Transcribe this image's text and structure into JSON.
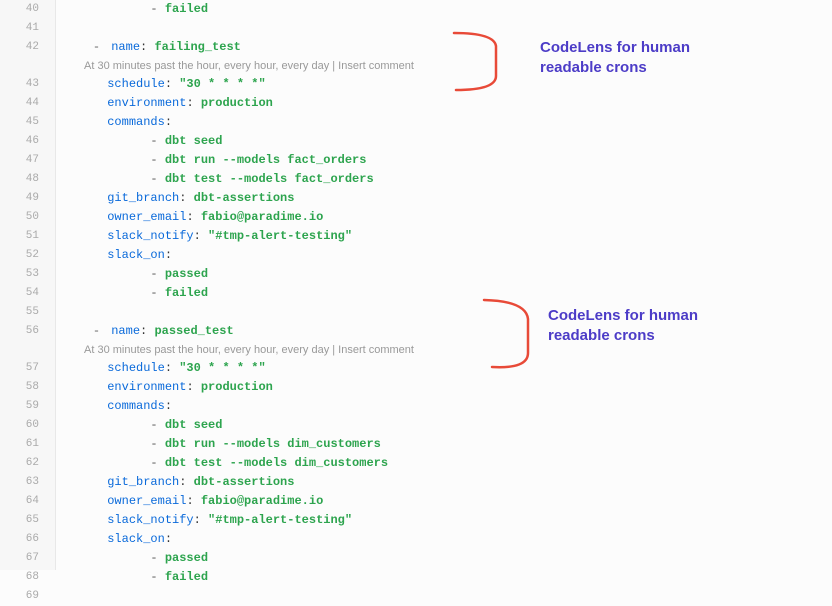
{
  "lines": [
    {
      "num": "40",
      "type": "code",
      "indent": "            ",
      "dash": true,
      "value": "failed"
    },
    {
      "num": "41",
      "type": "blank"
    },
    {
      "num": "42",
      "type": "fold",
      "indent": "    ",
      "key": "name",
      "value": "failing_test"
    },
    {
      "num": "",
      "type": "codelens",
      "text": "At 30 minutes past the hour, every hour, every day | Insert comment"
    },
    {
      "num": "43",
      "type": "kv",
      "indent": "      ",
      "key": "schedule",
      "value": "\"30 * * * *\""
    },
    {
      "num": "44",
      "type": "kv",
      "indent": "      ",
      "key": "environment",
      "value": "production"
    },
    {
      "num": "45",
      "type": "keyonly",
      "indent": "      ",
      "key": "commands"
    },
    {
      "num": "46",
      "type": "code",
      "indent": "            ",
      "dash": true,
      "value": "dbt seed"
    },
    {
      "num": "47",
      "type": "code",
      "indent": "            ",
      "dash": true,
      "value": "dbt run --models fact_orders"
    },
    {
      "num": "48",
      "type": "code",
      "indent": "            ",
      "dash": true,
      "value": "dbt test --models fact_orders"
    },
    {
      "num": "49",
      "type": "kv",
      "indent": "      ",
      "key": "git_branch",
      "value": "dbt-assertions"
    },
    {
      "num": "50",
      "type": "kv",
      "indent": "      ",
      "key": "owner_email",
      "value": "fabio@paradime.io"
    },
    {
      "num": "51",
      "type": "kv",
      "indent": "      ",
      "key": "slack_notify",
      "value": "\"#tmp-alert-testing\""
    },
    {
      "num": "52",
      "type": "keyonly",
      "indent": "      ",
      "key": "slack_on"
    },
    {
      "num": "53",
      "type": "code",
      "indent": "            ",
      "dash": true,
      "value": "passed"
    },
    {
      "num": "54",
      "type": "code",
      "indent": "            ",
      "dash": true,
      "value": "failed"
    },
    {
      "num": "55",
      "type": "blank"
    },
    {
      "num": "56",
      "type": "fold",
      "indent": "    ",
      "key": "name",
      "value": "passed_test"
    },
    {
      "num": "",
      "type": "codelens",
      "text": "At 30 minutes past the hour, every hour, every day | Insert comment"
    },
    {
      "num": "57",
      "type": "kv",
      "indent": "      ",
      "key": "schedule",
      "value": "\"30 * * * *\""
    },
    {
      "num": "58",
      "type": "kv",
      "indent": "      ",
      "key": "environment",
      "value": "production"
    },
    {
      "num": "59",
      "type": "keyonly",
      "indent": "      ",
      "key": "commands"
    },
    {
      "num": "60",
      "type": "code",
      "indent": "            ",
      "dash": true,
      "value": "dbt seed"
    },
    {
      "num": "61",
      "type": "code",
      "indent": "            ",
      "dash": true,
      "value": "dbt run --models dim_customers"
    },
    {
      "num": "62",
      "type": "code",
      "indent": "            ",
      "dash": true,
      "value": "dbt test --models dim_customers"
    },
    {
      "num": "63",
      "type": "kv",
      "indent": "      ",
      "key": "git_branch",
      "value": "dbt-assertions"
    },
    {
      "num": "64",
      "type": "kv",
      "indent": "      ",
      "key": "owner_email",
      "value": "fabio@paradime.io"
    },
    {
      "num": "65",
      "type": "kv",
      "indent": "      ",
      "key": "slack_notify",
      "value": "\"#tmp-alert-testing\""
    },
    {
      "num": "66",
      "type": "keyonly",
      "indent": "      ",
      "key": "slack_on"
    },
    {
      "num": "67",
      "type": "code",
      "indent": "            ",
      "dash": true,
      "value": "passed"
    },
    {
      "num": "68",
      "type": "code",
      "indent": "            ",
      "dash": true,
      "value": "failed"
    },
    {
      "num": "69",
      "type": "blank"
    }
  ],
  "annotations": {
    "label1": "CodeLens for human\nreadable crons",
    "label2": "CodeLens for human\nreadable crons"
  }
}
